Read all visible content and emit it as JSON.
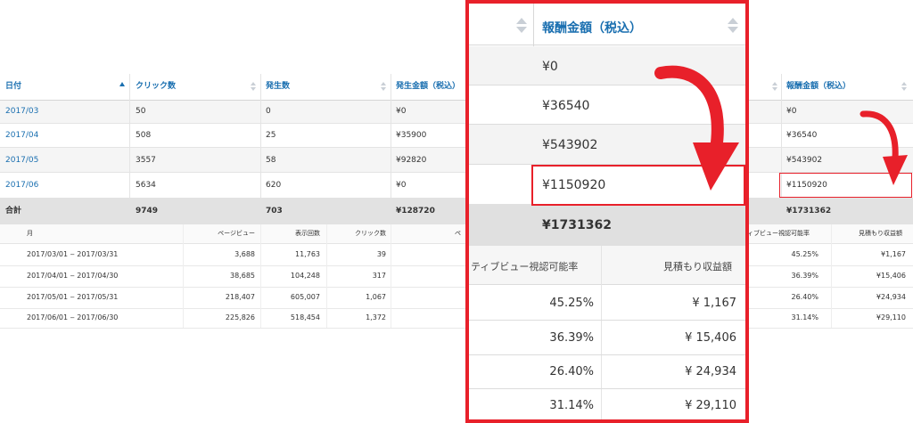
{
  "main_table": {
    "headers": [
      "日付",
      "クリック数",
      "発生数",
      "発生金額（税込）",
      "報酬金額（税込）"
    ],
    "rows": [
      {
        "date": "2017/03",
        "clicks": "50",
        "count": "0",
        "amount": "¥0",
        "reward": "¥0"
      },
      {
        "date": "2017/04",
        "clicks": "508",
        "count": "25",
        "amount": "¥35900",
        "reward": "¥36540"
      },
      {
        "date": "2017/05",
        "clicks": "3557",
        "count": "58",
        "amount": "¥92820",
        "reward": "¥543902"
      },
      {
        "date": "2017/06",
        "clicks": "5634",
        "count": "620",
        "amount": "¥0",
        "reward": "¥1150920"
      }
    ],
    "total": {
      "label": "合計",
      "clicks": "9749",
      "count": "703",
      "amount": "¥128720",
      "reward": "¥1731362"
    }
  },
  "sub_table": {
    "headers": [
      "月",
      "ページビュー",
      "表示回数",
      "クリック数",
      "ペ",
      "ィブビュー視認可能率",
      "見積もり収益額"
    ],
    "rows": [
      {
        "period": "2017/03/01 ‒ 2017/03/31",
        "pv": "3,688",
        "impressions": "11,763",
        "clicks": "39",
        "viewability": "45.25%",
        "revenue": "¥1,167"
      },
      {
        "period": "2017/04/01 ‒ 2017/04/30",
        "pv": "38,685",
        "impressions": "104,248",
        "clicks": "317",
        "viewability": "36.39%",
        "revenue": "¥15,406"
      },
      {
        "period": "2017/05/01 ‒ 2017/05/31",
        "pv": "218,407",
        "impressions": "605,007",
        "clicks": "1,067",
        "viewability": "26.40%",
        "revenue": "¥24,934"
      },
      {
        "period": "2017/06/01 ‒ 2017/06/30",
        "pv": "225,826",
        "impressions": "518,454",
        "clicks": "1,372",
        "viewability": "31.14%",
        "revenue": "¥29,110"
      }
    ]
  },
  "zoom": {
    "reward_header": "報酬金額（税込）",
    "rewards": [
      "¥0",
      "¥36540",
      "¥543902",
      "¥1150920"
    ],
    "reward_total": "¥1731362",
    "viewability_header": "ティブビュー視認可能率",
    "revenue_header": "見積もり収益額",
    "viewability": [
      "45.25%",
      "36.39%",
      "26.40%",
      "31.14%"
    ],
    "revenue": [
      "¥ 1,167",
      "¥ 15,406",
      "¥ 24,934",
      "¥ 29,110"
    ]
  },
  "colors": {
    "accent": "#1a6fb0",
    "highlight": "#e8202a",
    "total_bg": "#e2e2e2",
    "stripe_bg": "#f5f5f5"
  }
}
